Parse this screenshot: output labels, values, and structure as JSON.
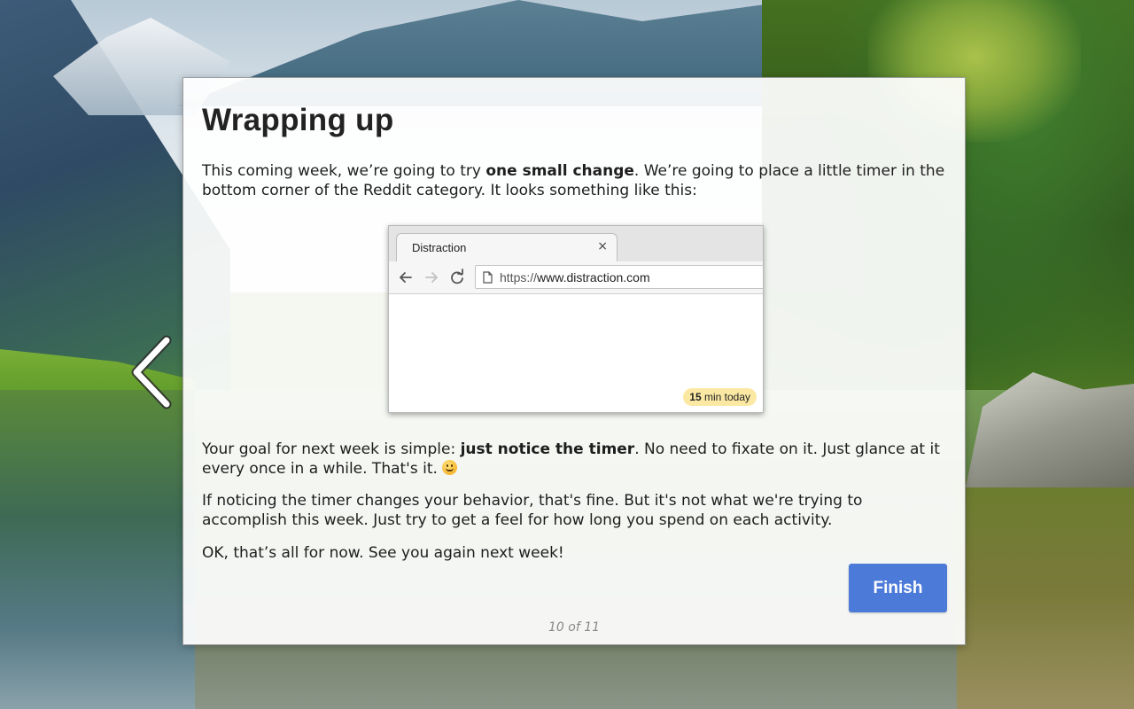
{
  "slide": {
    "title": "Wrapping up",
    "para1": {
      "before": "This coming week, we’re going to try ",
      "bold": "one small change",
      "after": ". We’re going to place a little timer in the bottom corner of the Reddit category. It looks something like this:"
    },
    "para2": {
      "before": "Your goal for next week is simple: ",
      "bold": "just notice the timer",
      "after": ". No need to fixate on it. Just glance at it every once in a while. That's it. "
    },
    "para3": "If noticing the timer changes your behavior, that's fine. But it's not what we're trying to accomplish this week. Just try to get a feel for how long you spend on each activity.",
    "para4": "OK, that’s all for now. See you again next week!",
    "finish_label": "Finish",
    "pager": "10 of 11"
  },
  "mock_browser": {
    "tab_title": "Distraction",
    "tab_close": "×",
    "url_scheme": "https://",
    "url_host": "www.distraction.com",
    "timer_value": "15",
    "timer_suffix": " min today"
  },
  "colors": {
    "accent": "#4c7ad8",
    "timer_badge": "#fbe9a3",
    "card_bg": "#ffffff"
  },
  "icons": {
    "prev": "chevron-left-icon",
    "back": "arrow-left-icon",
    "forward": "arrow-right-icon",
    "reload": "reload-icon",
    "page": "page-icon",
    "emoji": "smile-emoji-icon"
  }
}
